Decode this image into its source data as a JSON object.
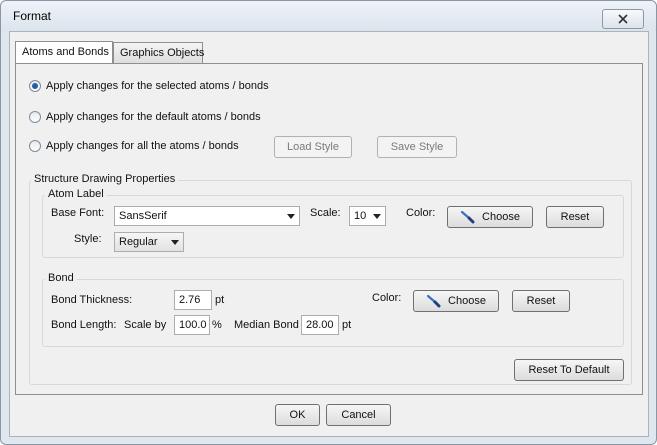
{
  "window": {
    "title": "Format"
  },
  "tabs": [
    {
      "label": "Atoms and Bonds",
      "active": true
    },
    {
      "label": "Graphics Objects",
      "active": false
    }
  ],
  "apply_options": {
    "selected": "Apply changes for the selected atoms / bonds",
    "default": "Apply changes for the default atoms / bonds",
    "all": "Apply changes for all the atoms / bonds",
    "checked": "selected"
  },
  "style_buttons": {
    "load": "Load Style",
    "save": "Save Style"
  },
  "structure": {
    "title": "Structure Drawing Properties",
    "atom_label": {
      "title": "Atom Label",
      "base_font_label": "Base Font:",
      "base_font_value": "SansSerif",
      "scale_label": "Scale:",
      "scale_value": "10",
      "color_label": "Color:",
      "choose": "Choose",
      "reset": "Reset",
      "style_label": "Style:",
      "style_value": "Regular"
    },
    "bond": {
      "title": "Bond",
      "thickness_label": "Bond Thickness:",
      "thickness_value": "2.76",
      "thickness_unit": "pt",
      "length_label": "Bond Length:",
      "scale_by_label": "Scale by",
      "scale_by_value": "100.0",
      "scale_by_unit": "%",
      "median_label": "Median Bond",
      "median_value": "28.00",
      "median_unit": "pt",
      "color_label": "Color:",
      "choose": "Choose",
      "reset": "Reset"
    },
    "reset_default": "Reset To Default"
  },
  "footer": {
    "ok": "OK",
    "cancel": "Cancel"
  },
  "icons": {
    "close": "close-icon",
    "brush": "paintbrush-icon"
  },
  "colors": {
    "radio_dot": "#2b5aa8",
    "brush_handle": "#3a6fc4"
  }
}
